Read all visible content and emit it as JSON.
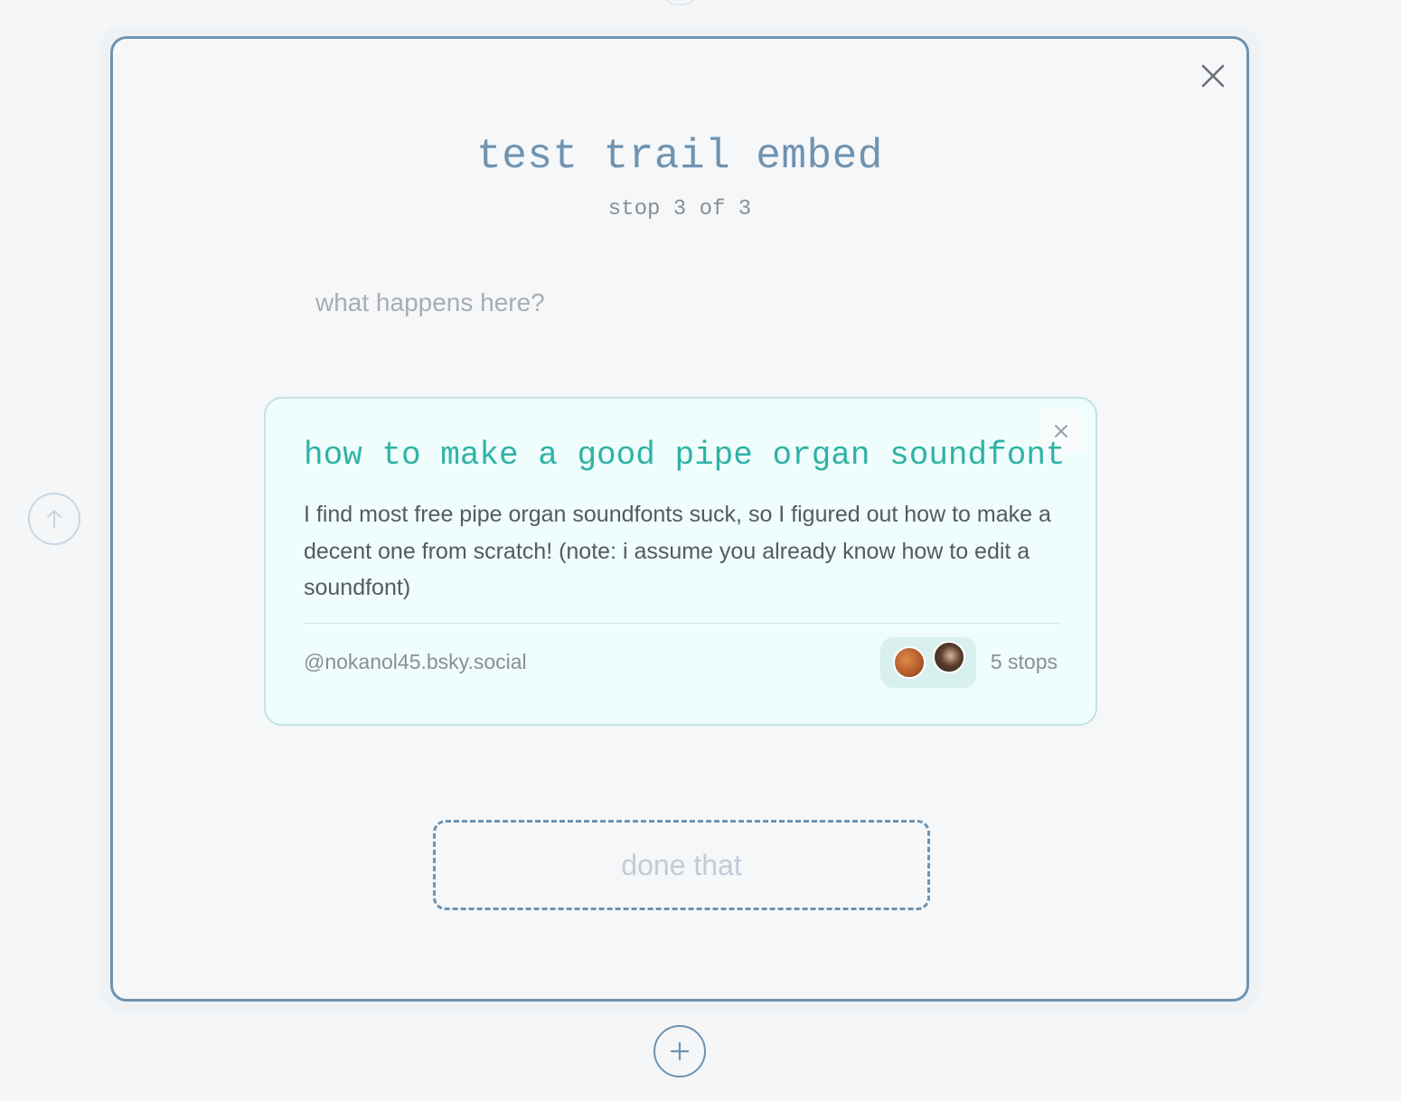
{
  "trail": {
    "title": "test trail embed",
    "progress": "stop 3 of 3"
  },
  "stop": {
    "placeholder": "what happens here?",
    "value": ""
  },
  "embed_card": {
    "title": "how to make a good pipe organ soundfont",
    "description": "I find most free pipe organ soundfonts suck, so I figured out how to make a decent one from scratch! (note: i assume you already know how to edit a soundfont)",
    "author": "@nokanol45.bsky.social",
    "stops": "5 stops",
    "accent_color": "#2fb3a6",
    "avatars": [
      "avatar-icon",
      "avatar-icon"
    ]
  },
  "actions": {
    "done_label": "done that"
  },
  "icons": {
    "close": "close-icon",
    "card_close": "close-icon",
    "up": "arrow-up-icon",
    "add": "plus-icon"
  },
  "colors": {
    "primary": "#6f93b0",
    "background": "#f4f6f8",
    "card_background": "#effdfc"
  }
}
